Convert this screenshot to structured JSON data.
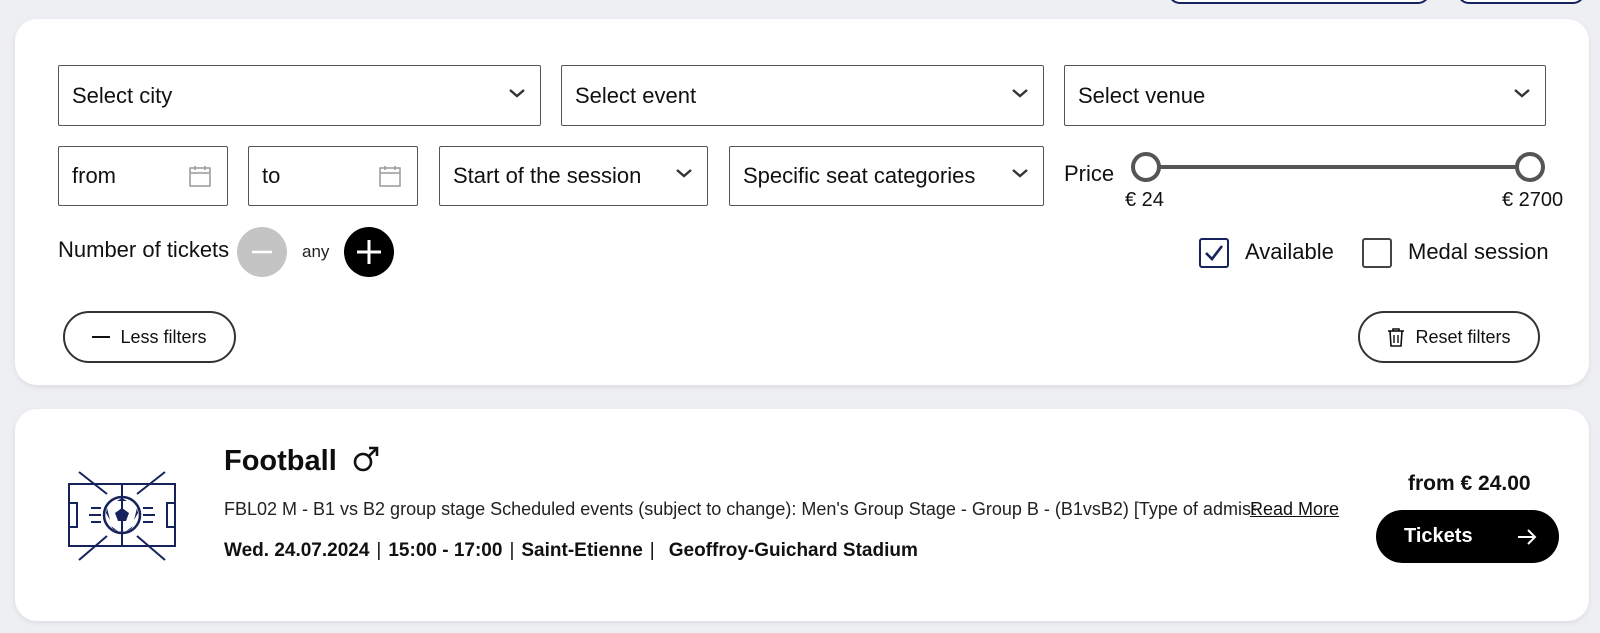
{
  "filters": {
    "city_placeholder": "Select city",
    "event_placeholder": "Select event",
    "venue_placeholder": "Select venue",
    "date_from": "from",
    "date_to": "to",
    "session_start": "Start of the session",
    "seat_categories": "Specific seat categories",
    "price_label": "Price",
    "price_min": "€ 24",
    "price_max": "€ 2700",
    "tickets_label": "Number of tickets",
    "tickets_value": "any",
    "available_label": "Available",
    "available_checked": true,
    "medal_label": "Medal session",
    "medal_checked": false,
    "less_filters_label": "Less filters",
    "reset_filters_label": "Reset filters"
  },
  "event": {
    "title": "Football",
    "gender_icon": "male-symbol-icon",
    "description": "FBL02 M - B1 vs B2 group stage Scheduled events (subject to change): Men's Group Stage - Group B - (B1vsB2) [Type of admission: Men]",
    "read_more": "Read More",
    "date": "Wed. 24.07.2024",
    "time": "15:00 - 17:00",
    "city": "Saint-Etienne",
    "venue": "Geoffroy-Guichard Stadium",
    "from_price": "from € 24.00",
    "tickets_button": "Tickets"
  },
  "colors": {
    "brand_navy": "#16225c",
    "button_black": "#000000"
  }
}
